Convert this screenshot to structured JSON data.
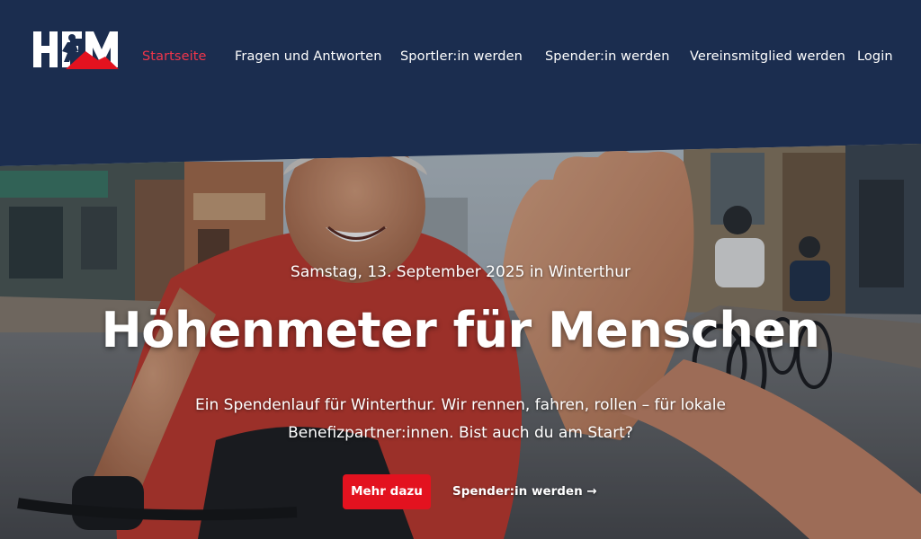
{
  "brand": {
    "logo_text": "HFM",
    "colors": {
      "navy": "#1b2d4f",
      "red": "#e3121f",
      "active": "#f0354a",
      "white": "#ffffff"
    }
  },
  "nav": {
    "items": [
      {
        "label": "Startseite",
        "active": true
      },
      {
        "label": "Fragen und Antworten",
        "active": false
      },
      {
        "label": "Sportler:in werden",
        "active": false
      },
      {
        "label": "Spender:in werden",
        "active": false
      },
      {
        "label": "Vereinsmitglied werden",
        "active": false
      },
      {
        "label": "Login",
        "active": false
      }
    ]
  },
  "hero": {
    "date": "Samstag, 13. September 2025 in Winterthur",
    "title": "Höhenmeter für Menschen",
    "lead": "Ein Spendenlauf für Winterthur. Wir rennen, fahren, rollen – für lokale Benefizpartner:innen. Bist auch du am Start?",
    "primary_button": "Mehr dazu",
    "secondary_link": "Spender:in werden →",
    "image_icon": "cyclists-high-five-photo"
  }
}
